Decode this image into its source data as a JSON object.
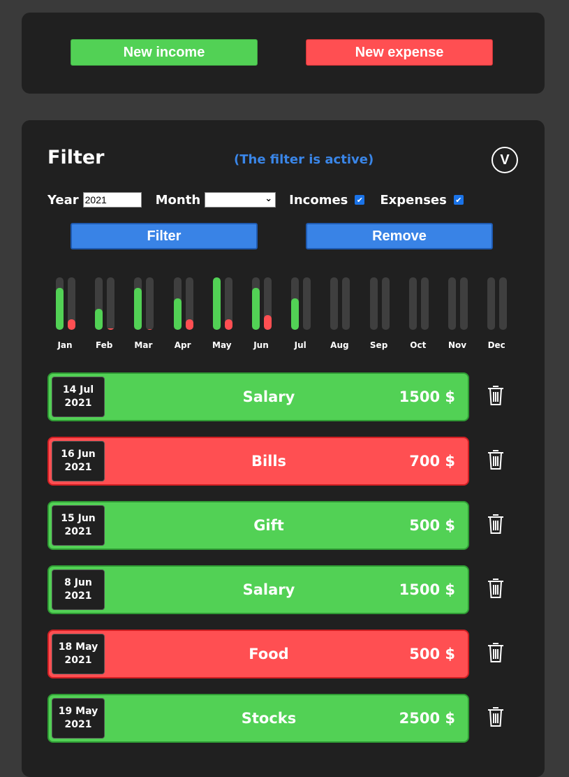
{
  "actions": {
    "new_income_label": "New income",
    "new_expense_label": "New expense"
  },
  "filter": {
    "title": "Filter",
    "status": "(The filter is active)",
    "toggle_label": "V",
    "year_label": "Year",
    "year_value": "2021",
    "month_label": "Month",
    "month_value": "",
    "incomes_label": "Incomes",
    "incomes_checked": true,
    "expenses_label": "Expenses",
    "expenses_checked": true,
    "filter_button": "Filter",
    "remove_button": "Remove"
  },
  "monthly_bars": {
    "income_color": "#52d155",
    "expense_color": "#ff4f52",
    "months": [
      {
        "label": "Jan",
        "income": 0.8,
        "expense": 0.2
      },
      {
        "label": "Feb",
        "income": 0.4,
        "expense": 0.03
      },
      {
        "label": "Mar",
        "income": 0.8,
        "expense": 0.02
      },
      {
        "label": "Apr",
        "income": 0.6,
        "expense": 0.2
      },
      {
        "label": "May",
        "income": 1.0,
        "expense": 0.2
      },
      {
        "label": "Jun",
        "income": 0.8,
        "expense": 0.28
      },
      {
        "label": "Jul",
        "income": 0.6,
        "expense": 0
      },
      {
        "label": "Aug",
        "income": 0,
        "expense": 0
      },
      {
        "label": "Sep",
        "income": 0,
        "expense": 0
      },
      {
        "label": "Oct",
        "income": 0,
        "expense": 0
      },
      {
        "label": "Nov",
        "income": 0,
        "expense": 0
      },
      {
        "label": "Dec",
        "income": 0,
        "expense": 0
      }
    ]
  },
  "transactions": [
    {
      "day": "14 Jul",
      "year": "2021",
      "name": "Salary",
      "amount": "1500 $",
      "type": "income"
    },
    {
      "day": "16 Jun",
      "year": "2021",
      "name": "Bills",
      "amount": "700 $",
      "type": "expense"
    },
    {
      "day": "15 Jun",
      "year": "2021",
      "name": "Gift",
      "amount": "500 $",
      "type": "income"
    },
    {
      "day": "8 Jun",
      "year": "2021",
      "name": "Salary",
      "amount": "1500 $",
      "type": "income"
    },
    {
      "day": "18 May",
      "year": "2021",
      "name": "Food",
      "amount": "500 $",
      "type": "expense"
    },
    {
      "day": "19 May",
      "year": "2021",
      "name": "Stocks",
      "amount": "2500 $",
      "type": "income"
    }
  ]
}
